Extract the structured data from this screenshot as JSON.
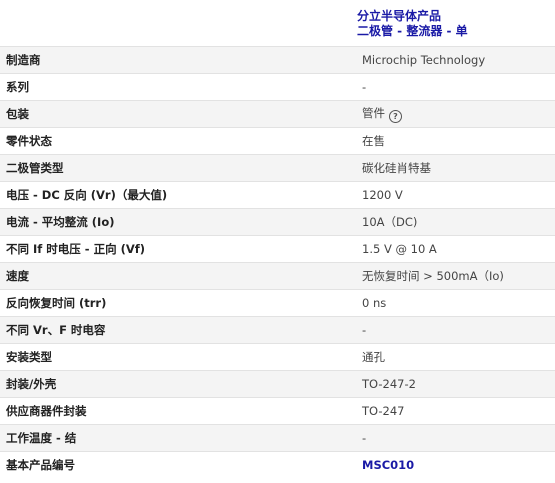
{
  "header": {
    "category_line1": "分立半导体产品",
    "category_line2": "二极管 - 整流器 - 单"
  },
  "rows": [
    {
      "label": "制造商",
      "value": "Microchip Technology"
    },
    {
      "label": "系列",
      "value": "-"
    },
    {
      "label": "包装",
      "value": "管件"
    },
    {
      "label": "零件状态",
      "value": "在售"
    },
    {
      "label": "二极管类型",
      "value": "碳化硅肖特基"
    },
    {
      "label": "电压 - DC 反向 (Vr)（最大值)",
      "value": "1200 V"
    },
    {
      "label": "电流 - 平均整流 (Io)",
      "value": "10A（DC)"
    },
    {
      "label": "不同 If 时电压 - 正向 (Vf)",
      "value": "1.5 V @ 10 A"
    },
    {
      "label": "速度",
      "value": "无恢复时间 > 500mA（Io)"
    },
    {
      "label": "反向恢复时间 (trr)",
      "value": "0 ns"
    },
    {
      "label": "不同 Vr、F 时电容",
      "value": "-"
    },
    {
      "label": "安装类型",
      "value": "通孔"
    },
    {
      "label": "封装/外壳",
      "value": "TO-247-2"
    },
    {
      "label": "供应商器件封装",
      "value": "TO-247"
    },
    {
      "label": "工作温度 - 结",
      "value": "-"
    },
    {
      "label": "基本产品编号",
      "value": "MSC010"
    }
  ],
  "icons": {
    "help": "help-circle-icon"
  },
  "colors": {
    "link": "#1a1aa6",
    "row_alt": "#f4f4f4",
    "border": "#e2e2e2"
  }
}
